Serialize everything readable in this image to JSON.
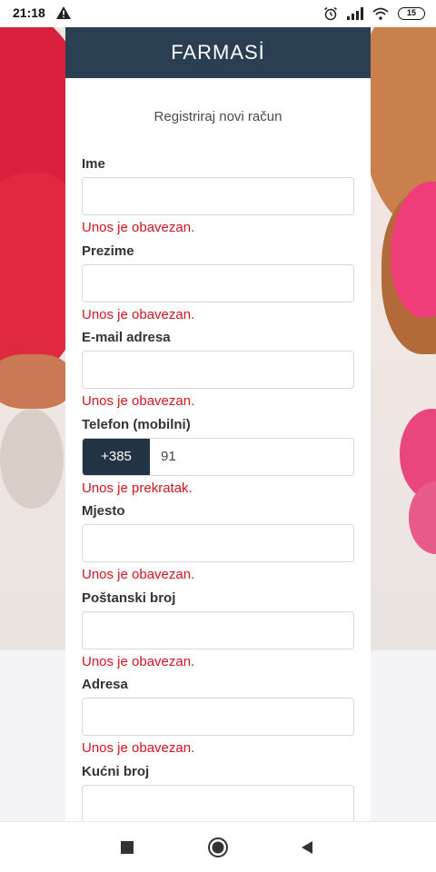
{
  "status_bar": {
    "time": "21:18",
    "warning_icon": "warning-triangle-icon",
    "battery_level": "15",
    "icons": [
      "alarm-icon",
      "signal-icon",
      "wifi-icon",
      "battery-icon"
    ]
  },
  "brand": {
    "logo_text": "FARMASİ",
    "header_color": "#2b3f52"
  },
  "form": {
    "title": "Registriraj novi račun",
    "fields": [
      {
        "label": "Ime",
        "value": "",
        "error": "Unos je obavezan."
      },
      {
        "label": "Prezime",
        "value": "",
        "error": "Unos je obavezan."
      },
      {
        "label": "E-mail adresa",
        "value": "",
        "error": "Unos je obavezan."
      },
      {
        "label": "Telefon (mobilni)",
        "prefix": "+385",
        "value": "91",
        "error": "Unos je prekratak."
      },
      {
        "label": "Mjesto",
        "value": "",
        "error": "Unos je obavezan."
      },
      {
        "label": "Poštanski broj",
        "value": "",
        "error": "Unos je obavezan."
      },
      {
        "label": "Adresa",
        "value": "",
        "error": "Unos je obavezan."
      },
      {
        "label": "Kućni broj",
        "value": ""
      }
    ],
    "error_color": "#d4141f"
  },
  "nav_bar": {
    "icons": [
      "recent-apps-icon",
      "home-icon",
      "back-icon"
    ]
  }
}
